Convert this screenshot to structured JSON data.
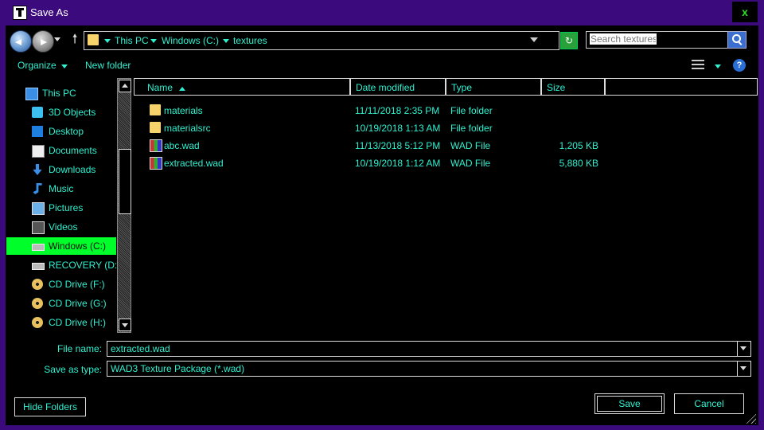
{
  "window": {
    "title": "Save As",
    "close_label": "x"
  },
  "address": {
    "breadcrumbs": [
      "This PC",
      "Windows (C:)",
      "textures"
    ]
  },
  "search": {
    "placeholder": "Search textures"
  },
  "toolbar": {
    "organize_label": "Organize",
    "new_folder_label": "New folder",
    "help_label": "?"
  },
  "nav": {
    "items": [
      {
        "label": "This PC",
        "icon": "computer-icon",
        "indent": false,
        "selected": false
      },
      {
        "label": "3D Objects",
        "icon": "3d-objects-icon",
        "indent": true,
        "selected": false
      },
      {
        "label": "Desktop",
        "icon": "desktop-icon",
        "indent": true,
        "selected": false
      },
      {
        "label": "Documents",
        "icon": "documents-icon",
        "indent": true,
        "selected": false
      },
      {
        "label": "Downloads",
        "icon": "downloads-icon",
        "indent": true,
        "selected": false
      },
      {
        "label": "Music",
        "icon": "music-icon",
        "indent": true,
        "selected": false
      },
      {
        "label": "Pictures",
        "icon": "pictures-icon",
        "indent": true,
        "selected": false
      },
      {
        "label": "Videos",
        "icon": "videos-icon",
        "indent": true,
        "selected": false
      },
      {
        "label": "Windows (C:)",
        "icon": "drive-icon",
        "indent": true,
        "selected": true
      },
      {
        "label": "RECOVERY (D:)",
        "icon": "drive-icon",
        "indent": true,
        "selected": false
      },
      {
        "label": "CD Drive (F:)",
        "icon": "cd-drive-icon",
        "indent": true,
        "selected": false
      },
      {
        "label": "CD Drive (G:)",
        "icon": "cd-drive-icon",
        "indent": true,
        "selected": false
      },
      {
        "label": "CD Drive (H:)",
        "icon": "cd-drive-icon",
        "indent": true,
        "selected": false
      }
    ]
  },
  "files": {
    "columns": [
      "Name",
      "Date modified",
      "Type",
      "Size"
    ],
    "rows": [
      {
        "name": "materials",
        "date": "11/11/2018 2:35 PM",
        "type": "File folder",
        "size": "",
        "icon": "folder-icon"
      },
      {
        "name": "materialsrc",
        "date": "10/19/2018 1:13 AM",
        "type": "File folder",
        "size": "",
        "icon": "folder-icon"
      },
      {
        "name": "abc.wad",
        "date": "11/13/2018 5:12 PM",
        "type": "WAD File",
        "size": "1,205 KB",
        "icon": "wad-file-icon"
      },
      {
        "name": "extracted.wad",
        "date": "10/19/2018 1:12 AM",
        "type": "WAD File",
        "size": "5,880 KB",
        "icon": "wad-file-icon"
      }
    ]
  },
  "form": {
    "filename_label": "File name:",
    "filename_value": "extracted.wad",
    "savetype_label": "Save as type:",
    "savetype_value": "WAD3 Texture Package (*.wad)"
  },
  "buttons": {
    "hide_folders": "Hide Folders",
    "save": "Save",
    "cancel": "Cancel"
  },
  "colors": {
    "text": "#2ff0d0",
    "frame": "#3b0a7d",
    "selection": "#00ff2a",
    "background": "#000000"
  }
}
